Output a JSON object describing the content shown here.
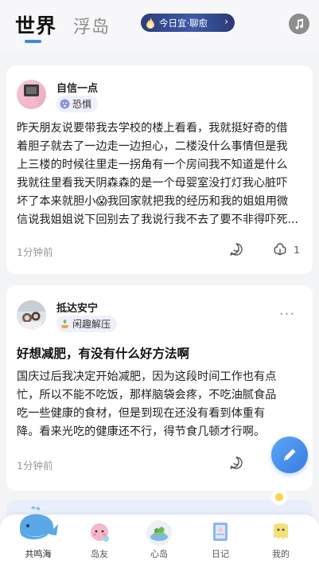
{
  "header": {
    "tab_world": "世界",
    "tab_island": "浮岛",
    "daily_banner": "今日宜·聊愈",
    "icons": {
      "banner_flame": "flame-icon",
      "music": "music-icon"
    }
  },
  "posts": [
    {
      "username": "自信一点",
      "mood": "恐惧",
      "title": "",
      "lines": [
        "昨天朋友说要带我去学校的楼上看看，我就挺好奇的借",
        "着胆子就去了一边走一边担心，二楼没什么事情但是我",
        "上三楼的时候往里走一拐角有一个房间我不知道是什么",
        "我就往里看我天阴森森的是一个母婴室没打灯我心脏吓",
        "坏了本来就胆小😱我回家就把我的经历和我的姐姐用微",
        "信说我姐姐说下回别去了我说行我不去了要不非得吓死..."
      ],
      "time": "1分钟前",
      "comment_count": "",
      "hug_count": "1"
    },
    {
      "username": "抵达安宁",
      "mood": "闲趣解压",
      "title": "好想减肥，有没有什么好方法啊",
      "lines": [
        "国庆过后我决定开始减肥，因为这段时间工作也有点",
        "忙，所以不能不吃饭，那样脑袋会疼，不吃油腻食品",
        "吃一些健康的食材，但是到现在还没有看到体重有",
        "降。看来光吃的健康还不行，得节食几顿才行啊。"
      ],
      "time": "1分钟前",
      "more": "···"
    }
  ],
  "nav": [
    {
      "label": "共鸣海",
      "icon": "whale-icon"
    },
    {
      "label": "岛友",
      "icon": "friend-icon"
    },
    {
      "label": "心岛",
      "icon": "island-icon"
    },
    {
      "label": "日记",
      "icon": "diary-icon"
    },
    {
      "label": "我的",
      "icon": "profile-icon"
    }
  ]
}
